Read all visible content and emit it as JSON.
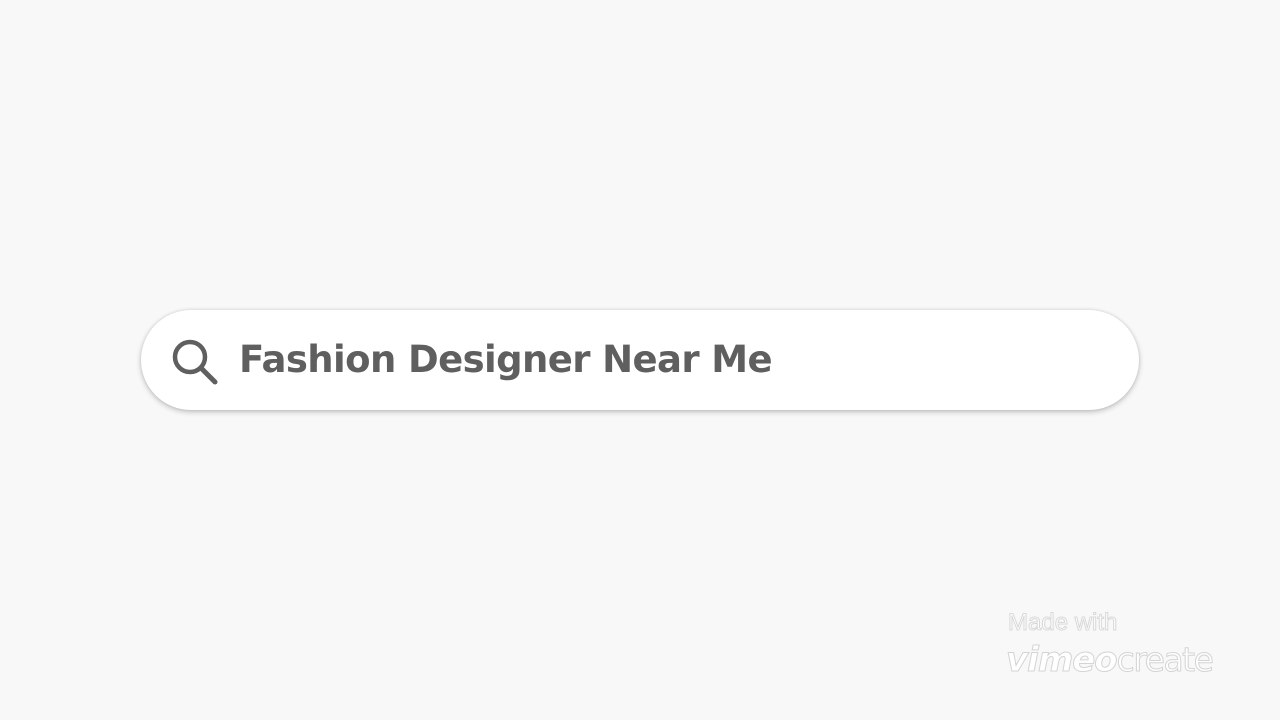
{
  "search": {
    "query": "Fashion Designer Near Me",
    "icon": "search-icon"
  },
  "watermark": {
    "made_with": "Made with",
    "brand_vimeo": "vimeo",
    "brand_create": "create"
  },
  "colors": {
    "background": "#f8f8f8",
    "search_bar": "#ffffff",
    "text": "#5f5f5f",
    "icon": "#5f5f5f"
  }
}
